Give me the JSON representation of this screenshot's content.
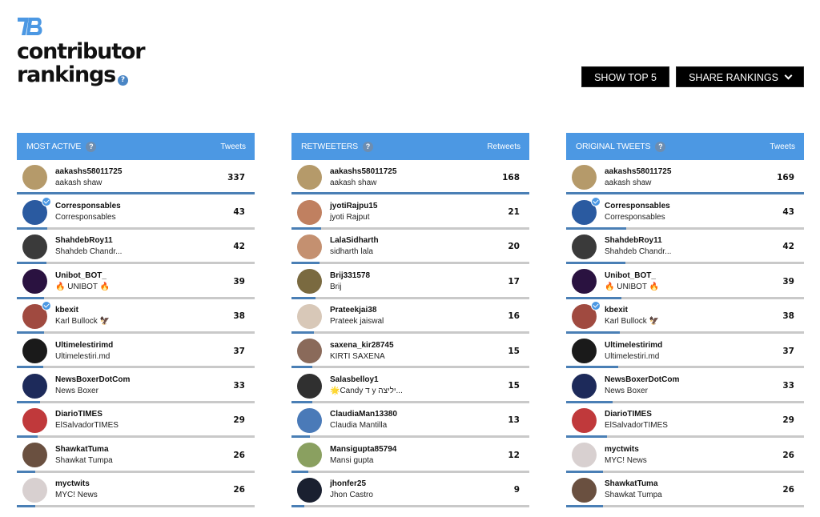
{
  "header": {
    "logo": "TB",
    "title_line1": "contributor",
    "title_line2": "rankings",
    "help_glyph": "?"
  },
  "toolbar": {
    "show_top_label": "SHOW TOP 5",
    "share_label": "SHARE RANKINGS",
    "share_icon": "chevron-down-icon"
  },
  "colors": {
    "accent": "#4c98e3",
    "bar_fill": "#4a7fb5",
    "bar_track": "#c9c9c9",
    "button_bg": "#000000"
  },
  "panels": [
    {
      "title": "MOST ACTIVE",
      "metric": "Tweets",
      "rows": [
        {
          "username": "aakashs58011725",
          "display": "aakash shaw",
          "count": 337,
          "share": 1.0,
          "verified": false,
          "avatar": "#b59a6a"
        },
        {
          "username": "Corresponsables",
          "display": "Corresponsables",
          "count": 43,
          "share": 0.128,
          "verified": true,
          "avatar": "#2a5aa0"
        },
        {
          "username": "ShahdebRoy11",
          "display": "Shahdeb Chandr...",
          "count": 42,
          "share": 0.125,
          "verified": false,
          "avatar": "#3a3a3a"
        },
        {
          "username": "Unibot_BOT_",
          "display": "🔥 UNIBOT 🔥",
          "count": 39,
          "share": 0.116,
          "verified": false,
          "avatar": "#2a1240"
        },
        {
          "username": "kbexit",
          "display": "Karl Bullock 🦅",
          "count": 38,
          "share": 0.113,
          "verified": true,
          "avatar": "#a04a40"
        },
        {
          "username": "Ultimelestirimd",
          "display": "Ultimelestiri.md",
          "count": 37,
          "share": 0.11,
          "verified": false,
          "avatar": "#1a1a1a"
        },
        {
          "username": "NewsBoxerDotCom",
          "display": "News Boxer",
          "count": 33,
          "share": 0.098,
          "verified": false,
          "avatar": "#1d2a5a"
        },
        {
          "username": "DiarioTIMES",
          "display": "ElSalvadorTIMES",
          "count": 29,
          "share": 0.086,
          "verified": false,
          "avatar": "#c0393b"
        },
        {
          "username": "ShawkatTuma",
          "display": "Shawkat Tumpa",
          "count": 26,
          "share": 0.077,
          "verified": false,
          "avatar": "#6a5040"
        },
        {
          "username": "myctwits",
          "display": "MYC! News",
          "count": 26,
          "share": 0.077,
          "verified": false,
          "avatar": "#d8d0d0"
        }
      ]
    },
    {
      "title": "RETWEETERS",
      "metric": "Retweets",
      "rows": [
        {
          "username": "aakashs58011725",
          "display": "aakash shaw",
          "count": 168,
          "share": 1.0,
          "verified": false,
          "avatar": "#b59a6a"
        },
        {
          "username": "jyotiRajpu15",
          "display": "jyoti Rajput",
          "count": 21,
          "share": 0.125,
          "verified": false,
          "avatar": "#c08060"
        },
        {
          "username": "LalaSidharth",
          "display": "sidharth lala",
          "count": 20,
          "share": 0.119,
          "verified": false,
          "avatar": "#c49070"
        },
        {
          "username": "Brij331578",
          "display": "Brij",
          "count": 17,
          "share": 0.101,
          "verified": false,
          "avatar": "#7a6a40"
        },
        {
          "username": "Prateekjai38",
          "display": "Prateek jaiswal",
          "count": 16,
          "share": 0.095,
          "verified": false,
          "avatar": "#d8c8b8"
        },
        {
          "username": "saxena_kir28745",
          "display": "KIRTI SAXENA",
          "count": 15,
          "share": 0.089,
          "verified": false,
          "avatar": "#8a6a5a"
        },
        {
          "username": "Salasbelloy1",
          "display": "🌟Candy ד y יליצה...",
          "count": 15,
          "share": 0.089,
          "verified": false,
          "avatar": "#303030"
        },
        {
          "username": "ClaudiaMan13380",
          "display": "Claudia Mantilla",
          "count": 13,
          "share": 0.077,
          "verified": false,
          "avatar": "#4a7ab8"
        },
        {
          "username": "Mansigupta85794",
          "display": "Mansi gupta",
          "count": 12,
          "share": 0.071,
          "verified": false,
          "avatar": "#8aa060"
        },
        {
          "username": "jhonfer25",
          "display": "Jhon Castro",
          "count": 9,
          "share": 0.054,
          "verified": false,
          "avatar": "#1a2030"
        }
      ]
    },
    {
      "title": "ORIGINAL TWEETS",
      "metric": "Tweets",
      "rows": [
        {
          "username": "aakashs58011725",
          "display": "aakash shaw",
          "count": 169,
          "share": 1.0,
          "verified": false,
          "avatar": "#b59a6a"
        },
        {
          "username": "Corresponsables",
          "display": "Corresponsables",
          "count": 43,
          "share": 0.254,
          "verified": true,
          "avatar": "#2a5aa0"
        },
        {
          "username": "ShahdebRoy11",
          "display": "Shahdeb Chandr...",
          "count": 42,
          "share": 0.249,
          "verified": false,
          "avatar": "#3a3a3a"
        },
        {
          "username": "Unibot_BOT_",
          "display": "🔥 UNIBOT 🔥",
          "count": 39,
          "share": 0.231,
          "verified": false,
          "avatar": "#2a1240"
        },
        {
          "username": "kbexit",
          "display": "Karl Bullock 🦅",
          "count": 38,
          "share": 0.225,
          "verified": true,
          "avatar": "#a04a40"
        },
        {
          "username": "Ultimelestirimd",
          "display": "Ultimelestiri.md",
          "count": 37,
          "share": 0.219,
          "verified": false,
          "avatar": "#1a1a1a"
        },
        {
          "username": "NewsBoxerDotCom",
          "display": "News Boxer",
          "count": 33,
          "share": 0.195,
          "verified": false,
          "avatar": "#1d2a5a"
        },
        {
          "username": "DiarioTIMES",
          "display": "ElSalvadorTIMES",
          "count": 29,
          "share": 0.172,
          "verified": false,
          "avatar": "#c0393b"
        },
        {
          "username": "myctwits",
          "display": "MYC! News",
          "count": 26,
          "share": 0.154,
          "verified": false,
          "avatar": "#d8d0d0"
        },
        {
          "username": "ShawkatTuma",
          "display": "Shawkat Tumpa",
          "count": 26,
          "share": 0.154,
          "verified": false,
          "avatar": "#6a5040"
        }
      ]
    }
  ]
}
